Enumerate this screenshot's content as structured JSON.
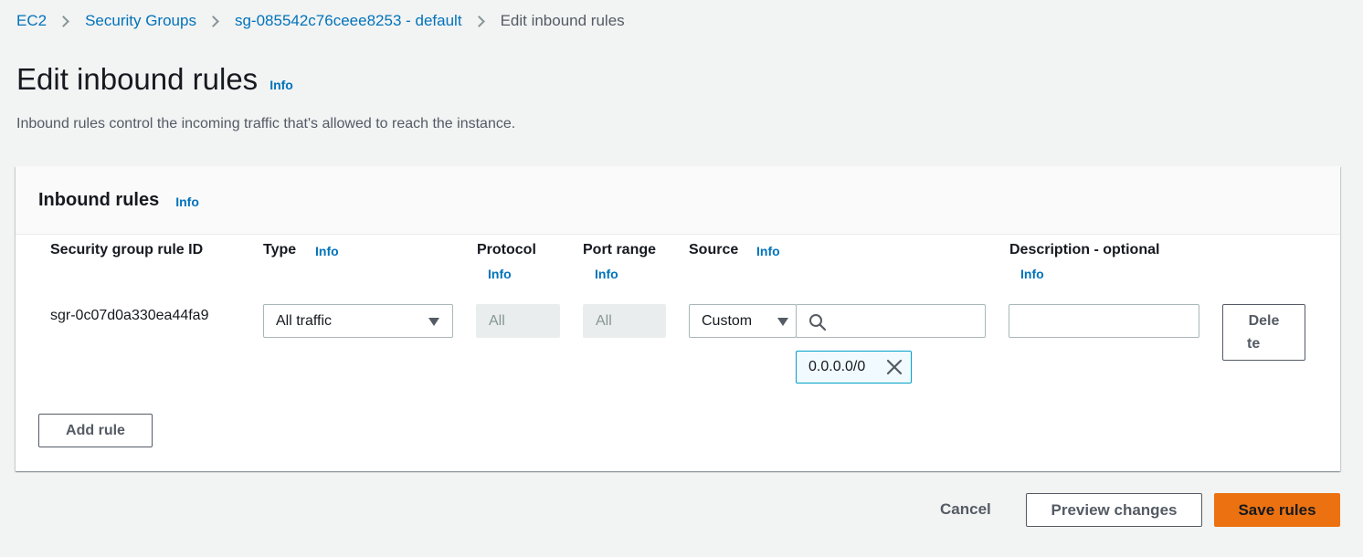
{
  "breadcrumb": {
    "items": [
      "EC2",
      "Security Groups",
      "sg-085542c76ceee8253 - default"
    ],
    "current": "Edit inbound rules"
  },
  "page": {
    "title": "Edit inbound rules",
    "info": "Info",
    "description": "Inbound rules control the incoming traffic that's allowed to reach the instance."
  },
  "panel": {
    "title": "Inbound rules",
    "info": "Info",
    "columns": {
      "rule_id": "Security group rule ID",
      "type": "Type",
      "protocol": "Protocol",
      "port_range": "Port range",
      "source": "Source",
      "description": "Description - optional",
      "info": "Info"
    },
    "rule": {
      "id": "sgr-0c07d0a330ea44fa9",
      "type": "All traffic",
      "protocol": "All",
      "port_range": "All",
      "source_type": "Custom",
      "source_search_value": "",
      "source_token": "0.0.0.0/0",
      "description_value": "",
      "delete_line1": "Dele",
      "delete_line2": "te"
    },
    "add_rule": "Add rule"
  },
  "footer": {
    "cancel": "Cancel",
    "preview": "Preview changes",
    "save": "Save rules"
  },
  "icons": {
    "breadcrumb_separator": "chevron-right-icon",
    "dropdown": "caret-down-icon",
    "search": "search-icon",
    "remove": "close-icon"
  },
  "colors": {
    "link": "#0073bb",
    "primary_button": "#ec7211",
    "token_border": "#00a1c9",
    "background": "#f2f3f3"
  }
}
